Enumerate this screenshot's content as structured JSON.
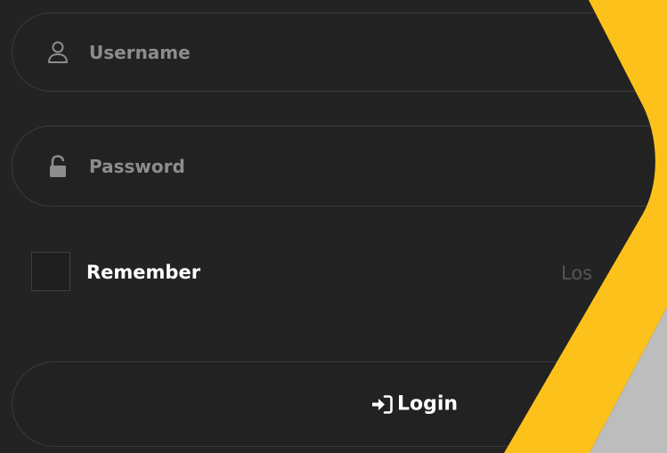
{
  "form": {
    "username": {
      "placeholder": "Username",
      "value": "",
      "icon": "user-icon"
    },
    "password": {
      "placeholder": "Password",
      "value": "",
      "icon": "unlock-icon"
    },
    "remember": {
      "label": "Remember",
      "checked": false
    },
    "lost_link": {
      "label": "Los"
    },
    "login_button": {
      "label": "Login",
      "icon": "sign-in-icon"
    }
  },
  "colors": {
    "background": "#232323",
    "field_border": "#3b3b3b",
    "placeholder_text": "#8d8d8d",
    "accent_yellow": "#fcc21b",
    "accent_gray": "#bdbdbd"
  }
}
